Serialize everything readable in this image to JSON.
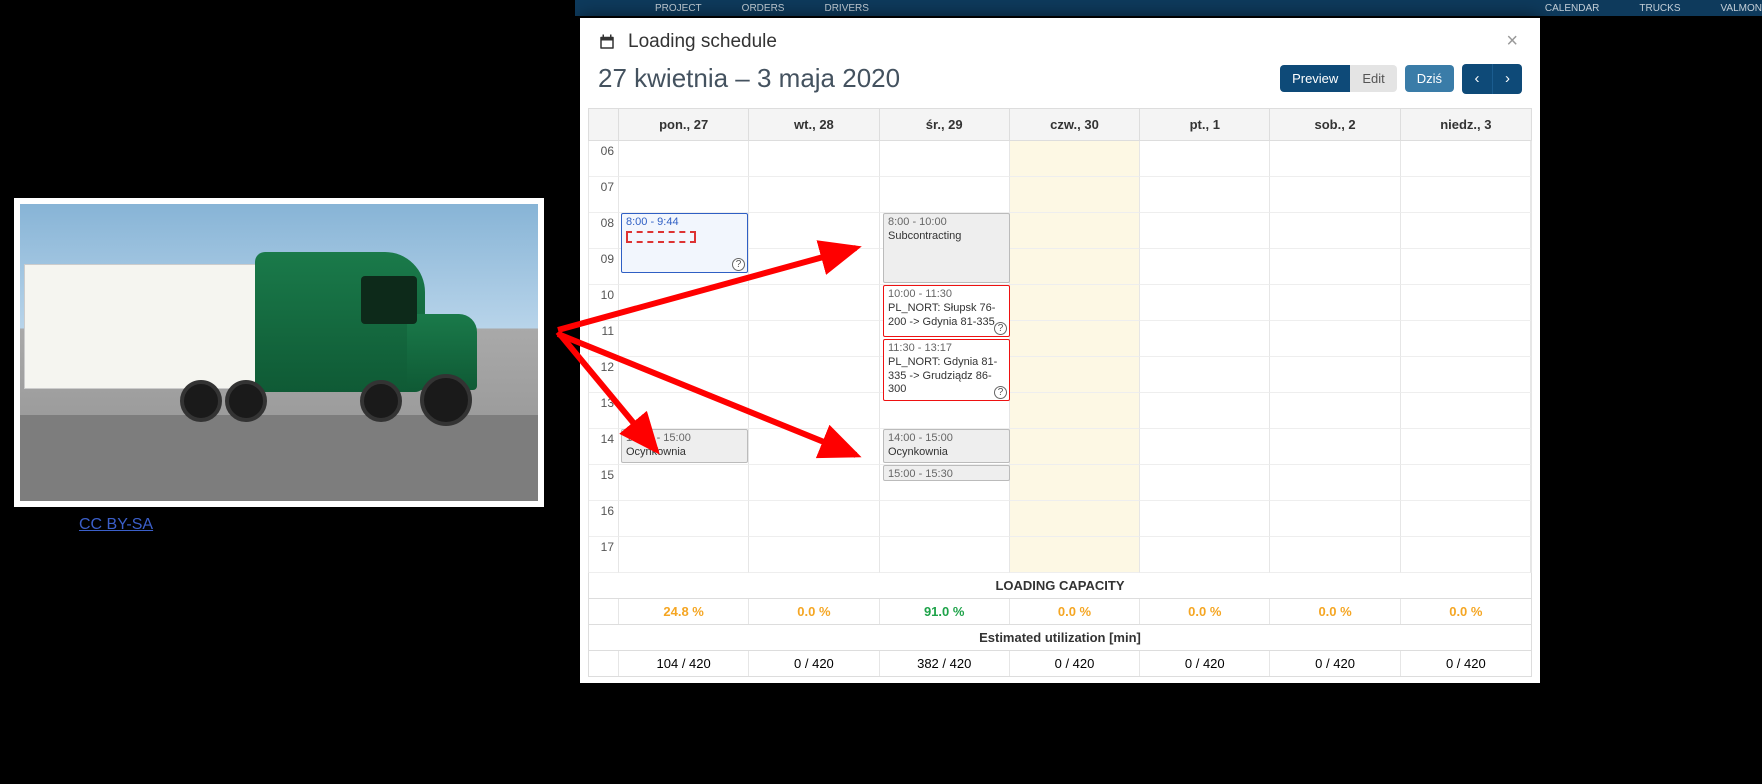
{
  "nav": {
    "items": [
      "PROJECT",
      "ORDERS",
      "DRIVERS",
      "CALENDAR",
      "TRUCKS",
      "VALMON"
    ]
  },
  "left": {
    "cc_label": "CC BY-SA"
  },
  "modal": {
    "title": "Loading schedule",
    "close": "×",
    "date_range": "27 kwietnia – 3 maja 2020",
    "preview": "Preview",
    "edit": "Edit",
    "today": "Dziś"
  },
  "days": [
    "pon., 27",
    "wt., 28",
    "śr., 29",
    "czw., 30",
    "pt., 1",
    "sob., 2",
    "niedz., 3"
  ],
  "hours": [
    "06",
    "07",
    "08",
    "09",
    "10",
    "11",
    "12",
    "13",
    "14",
    "15",
    "16",
    "17"
  ],
  "events": {
    "mon_0800": {
      "time": "8:00 - 9:44"
    },
    "mon_1400": {
      "time": "14:00 - 15:00",
      "text": "Ocynkownia"
    },
    "wed_0800": {
      "time": "8:00 - 10:00",
      "text": "Subcontracting"
    },
    "wed_1000": {
      "time": "10:00 - 11:30",
      "text": "PL_NORT: Słupsk 76-200 -> Gdynia 81-335"
    },
    "wed_1130": {
      "time": "11:30 - 13:17",
      "text": "PL_NORT: Gdynia 81-335 -> Grudziądz 86-300"
    },
    "wed_1400": {
      "time": "14:00 - 15:00",
      "text": "Ocynkownia"
    },
    "wed_1500": {
      "time": "15:00 - 15:30"
    }
  },
  "capacity": {
    "title": "LOADING CAPACITY",
    "pct": [
      "24.8 %",
      "0.0 %",
      "91.0 %",
      "0.0 %",
      "0.0 %",
      "0.0 %",
      "0.0 %"
    ],
    "util_title": "Estimated utilization [min]",
    "util": [
      "104 / 420",
      "0 / 420",
      "382 / 420",
      "0 / 420",
      "0 / 420",
      "0 / 420",
      "0 / 420"
    ]
  }
}
